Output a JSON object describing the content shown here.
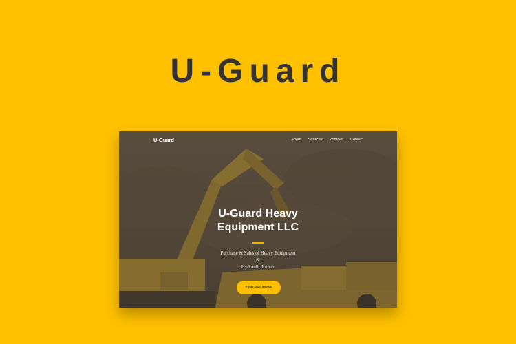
{
  "banner": {
    "title": "U-Guard"
  },
  "site": {
    "nav": {
      "brand": "U-Guard",
      "links": [
        "About",
        "Services",
        "Portfolio",
        "Contact"
      ]
    },
    "hero": {
      "title_line1": "U-Guard Heavy",
      "title_line2": "Equipment LLC",
      "subtitle_line1": "Purchase & Sales of Heavy Equipment",
      "subtitle_line2": "&",
      "subtitle_line3": "Hydraulic Repair",
      "cta_label": "FIND OUT MORE",
      "background_image": "excavator-and-dump-truck-photo"
    }
  },
  "colors": {
    "page_background": "#FFC000",
    "accent": "#FFBE00",
    "title_text": "#333333"
  }
}
